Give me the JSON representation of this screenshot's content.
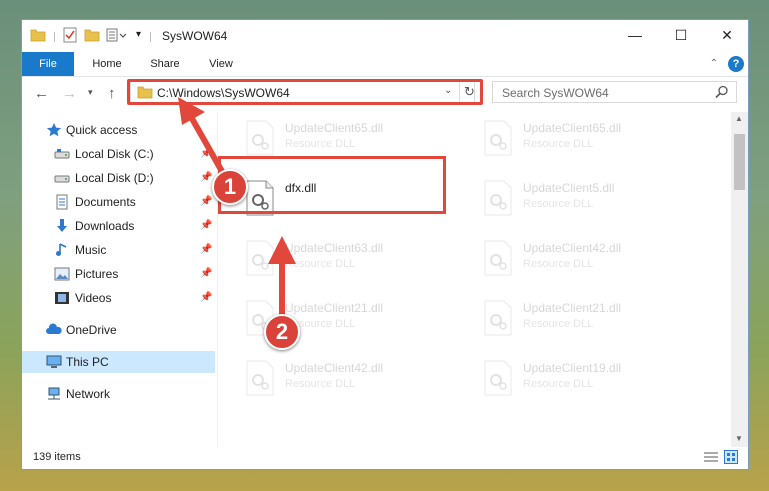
{
  "window": {
    "title": "SysWOW64",
    "controls": {
      "minimize": "—",
      "maximize": "☐",
      "close": "✕"
    }
  },
  "ribbon": {
    "tabs": [
      "File",
      "Home",
      "Share",
      "View"
    ],
    "collapse_icon": "chevron-up-icon",
    "help_icon": "help-icon",
    "help_label": "?"
  },
  "address_bar": {
    "path": "C:\\Windows\\SysWOW64",
    "refresh_icon": "refresh-icon"
  },
  "search": {
    "placeholder": "Search SysWOW64"
  },
  "nav_pane": {
    "quick_access": "Quick access",
    "items": [
      {
        "label": "Local Disk (C:)",
        "icon": "drive-icon",
        "pinned": true
      },
      {
        "label": "Local Disk (D:)",
        "icon": "drive-icon",
        "pinned": true
      },
      {
        "label": "Documents",
        "icon": "documents-icon",
        "pinned": true
      },
      {
        "label": "Downloads",
        "icon": "downloads-icon",
        "pinned": true
      },
      {
        "label": "Music",
        "icon": "music-icon",
        "pinned": true
      },
      {
        "label": "Pictures",
        "icon": "pictures-icon",
        "pinned": true
      },
      {
        "label": "Videos",
        "icon": "videos-icon",
        "pinned": true
      }
    ],
    "onedrive": "OneDrive",
    "this_pc": "This PC",
    "network": "Network"
  },
  "files": {
    "left": [
      {
        "name": "UpdateClient65.dll",
        "type": "Resource DLL"
      },
      {
        "name": "dfx.dll",
        "type": ""
      },
      {
        "name": "UpdateClient63.dll",
        "type": "Resource DLL"
      },
      {
        "name": "UpdateClient21.dll",
        "type": "Resource DLL"
      },
      {
        "name": "UpdateClient42.dll",
        "type": "Resource DLL"
      }
    ],
    "right": [
      {
        "name": "UpdateClient65.dll",
        "type": "Resource DLL"
      },
      {
        "name": "UpdateClient5.dll",
        "type": "Resource DLL"
      },
      {
        "name": "UpdateClient42.dll",
        "type": "Resource DLL"
      },
      {
        "name": "UpdateClient21.dll",
        "type": "Resource DLL"
      },
      {
        "name": "UpdateClient19.dll",
        "type": "Resource DLL"
      }
    ]
  },
  "status_bar": {
    "item_count": "139 items"
  },
  "annotations": {
    "badge_1": "1",
    "badge_2": "2",
    "color": "#d9433a"
  }
}
